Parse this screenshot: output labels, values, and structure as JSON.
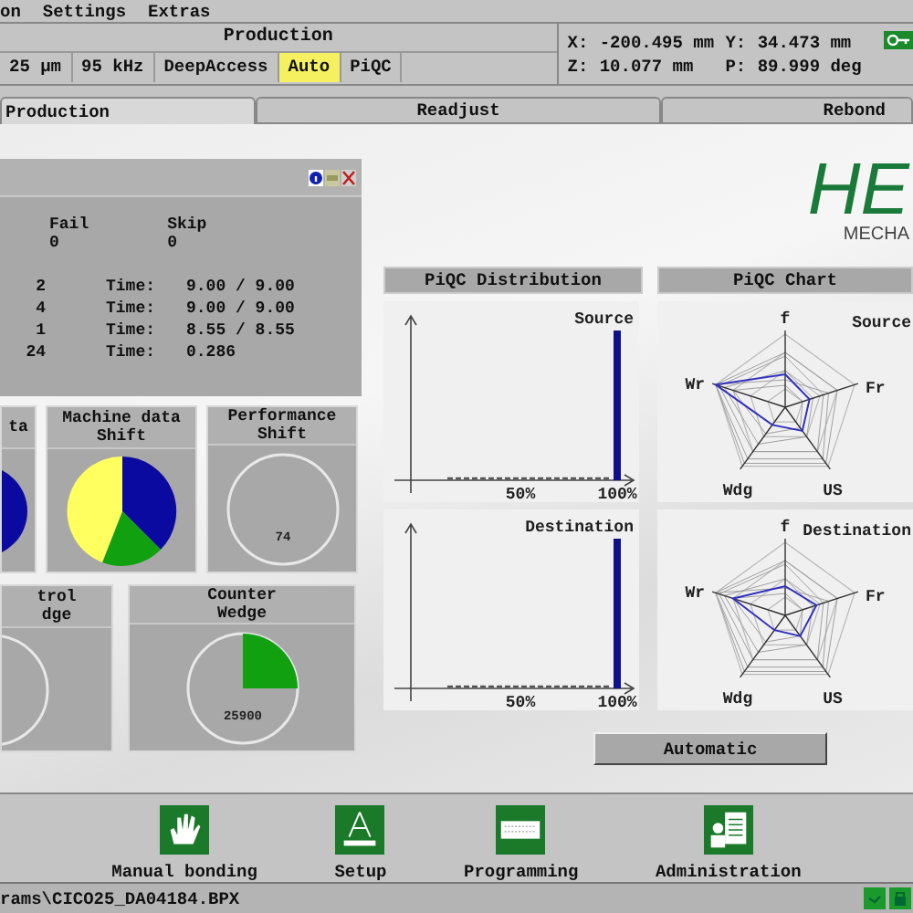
{
  "menu": [
    {
      "label": "on"
    },
    {
      "label": "Settings"
    },
    {
      "label": "Extras"
    }
  ],
  "header": {
    "title": "Production",
    "modes": [
      {
        "label": "25 μm",
        "selected": false
      },
      {
        "label": "95 kHz",
        "selected": false
      },
      {
        "label": "DeepAccess",
        "selected": false
      },
      {
        "label": "Auto",
        "selected": true
      },
      {
        "label": "PiQC",
        "selected": false
      }
    ],
    "coords": [
      {
        "axis": "X:",
        "value": "-200.495 mm"
      },
      {
        "axis": "Y:",
        "value": "34.473 mm"
      },
      {
        "axis": "Z:",
        "value": "10.077 mm"
      },
      {
        "axis": "P:",
        "value": "89.999 deg"
      }
    ]
  },
  "tabs": [
    {
      "label": "Production",
      "selected": true
    },
    {
      "label": "Readjust",
      "selected": false
    },
    {
      "label": "Rebond",
      "selected": false
    }
  ],
  "stats_window": {
    "columns": [
      {
        "label": "Fail",
        "value": "0"
      },
      {
        "label": "Skip",
        "value": "0"
      }
    ],
    "rows": [
      {
        "count": "2",
        "label": "Time:",
        "value": "9.00 / 9.00"
      },
      {
        "count": "4",
        "label": "Time:",
        "value": "9.00 / 9.00"
      },
      {
        "count": "1",
        "label": "Time:",
        "value": "8.55 / 8.55"
      },
      {
        "count": "24",
        "label": "Time:",
        "value": "0.286"
      }
    ]
  },
  "tiles": [
    [
      {
        "title": [
          "ta"
        ],
        "kind": "pie-cut"
      },
      {
        "title": [
          "Machine data",
          "Shift"
        ],
        "kind": "pie"
      },
      {
        "title": [
          "Performance",
          "Shift"
        ],
        "kind": "gauge",
        "reading": "74"
      }
    ],
    [
      {
        "title": [
          "trol",
          "dge"
        ],
        "kind": "gauge-cut"
      },
      {
        "title": [
          "Counter",
          "Wedge"
        ],
        "kind": "gauge-sector",
        "reading": "25900"
      }
    ]
  ],
  "logo": {
    "name": "HE",
    "tagline": "MECHA"
  },
  "distribution": {
    "title": "PiQC Distribution",
    "plots": [
      {
        "label": "Source",
        "ticks": [
          "50%",
          "100%"
        ]
      },
      {
        "label": "Destination",
        "ticks": [
          "50%",
          "100%"
        ]
      }
    ]
  },
  "radar": {
    "title": "PiQC Chart",
    "plots": [
      {
        "label": "Source",
        "axes": [
          "f",
          "Wr",
          "Fr",
          "Wdg",
          "US"
        ]
      },
      {
        "label": "Destination",
        "axes": [
          "f",
          "Wr",
          "Fr",
          "Wdg",
          "US"
        ]
      }
    ]
  },
  "automatic_button": "Automatic",
  "toolbar": [
    {
      "label": "Manual bonding",
      "kind": "hand"
    },
    {
      "label": "Setup",
      "kind": "setup"
    },
    {
      "label": "Programming",
      "kind": "keyboard"
    },
    {
      "label": "Administration",
      "kind": "admin"
    }
  ],
  "status_bar": {
    "path": "rams\\CICO25_DA04184.BPX"
  }
}
